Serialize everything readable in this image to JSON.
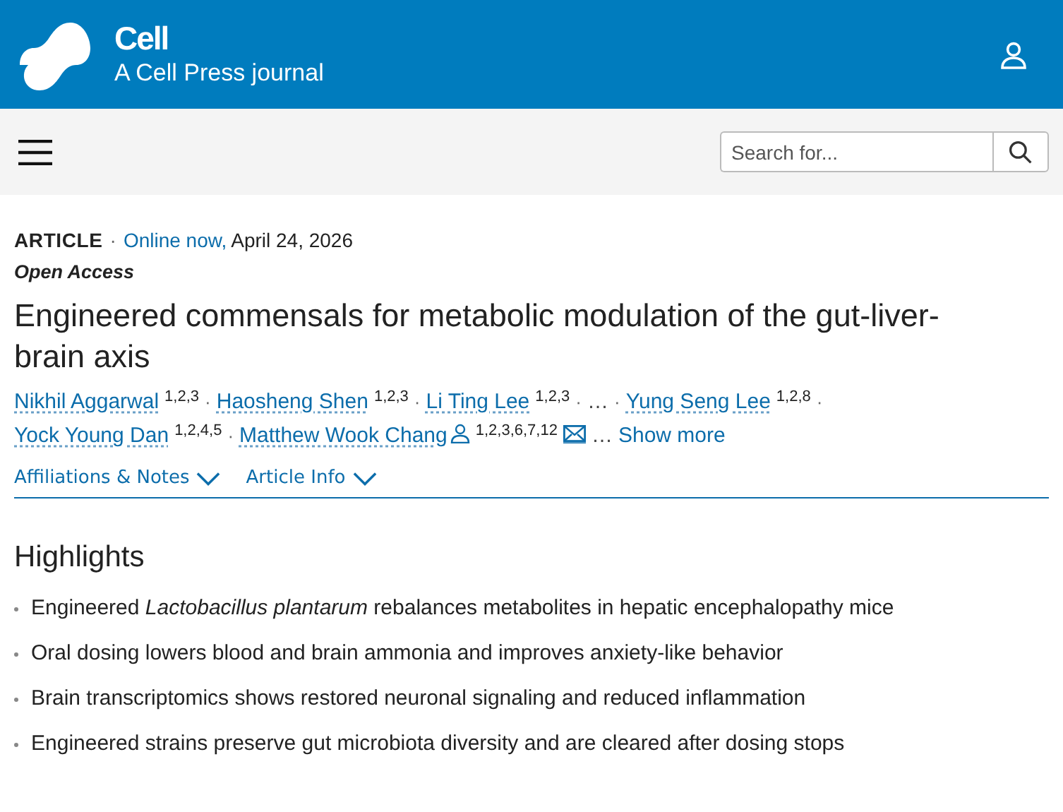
{
  "header": {
    "journal": "Cell",
    "tagline": "A Cell Press journal"
  },
  "search": {
    "placeholder": "Search for..."
  },
  "article": {
    "type": "ARTICLE",
    "separator": "·",
    "status": "Online now,",
    "date": "April 24, 2026",
    "access": "Open Access",
    "title": "Engineered commensals for metabolic modulation of the gut-liver-brain axis"
  },
  "authors": [
    {
      "kind": "author",
      "name": "Nikhil Aggarwal",
      "sup": "1,2,3",
      "separator": "·"
    },
    {
      "kind": "author",
      "name": "Haosheng Shen",
      "sup": "1,2,3",
      "separator": "·"
    },
    {
      "kind": "author",
      "name": "Li Ting Lee",
      "sup": "1,2,3",
      "separator": "·"
    },
    {
      "kind": "ellipsis",
      "text": "…",
      "separator": "·"
    },
    {
      "kind": "author",
      "name": "Yung Seng Lee",
      "sup": "1,2,8",
      "separator": "·"
    },
    {
      "kind": "author",
      "name": "Yock Young Dan",
      "sup": "1,2,4,5",
      "separator": "·"
    },
    {
      "kind": "author",
      "name": "Matthew Wook Chang",
      "sup": "1,2,3,6,7,12",
      "corresponding": true,
      "email": true
    },
    {
      "kind": "ellipsis",
      "text": "…"
    }
  ],
  "show_more": "Show more",
  "info_tabs": [
    {
      "label": "Affiliations & Notes",
      "expanded": false
    },
    {
      "label": "Article Info",
      "expanded": false
    }
  ],
  "highlights": {
    "title": "Highlights",
    "items": [
      "Engineered *Lactobacillus plantarum* rebalances metabolites in hepatic encephalopathy mice",
      "Oral dosing lowers blood and brain ammonia and improves anxiety-like behavior",
      "Brain transcriptomics shows restored neuronal signaling and reduced inflammation",
      "Engineered strains preserve gut microbiota diversity and are cleared after dosing stops"
    ]
  }
}
